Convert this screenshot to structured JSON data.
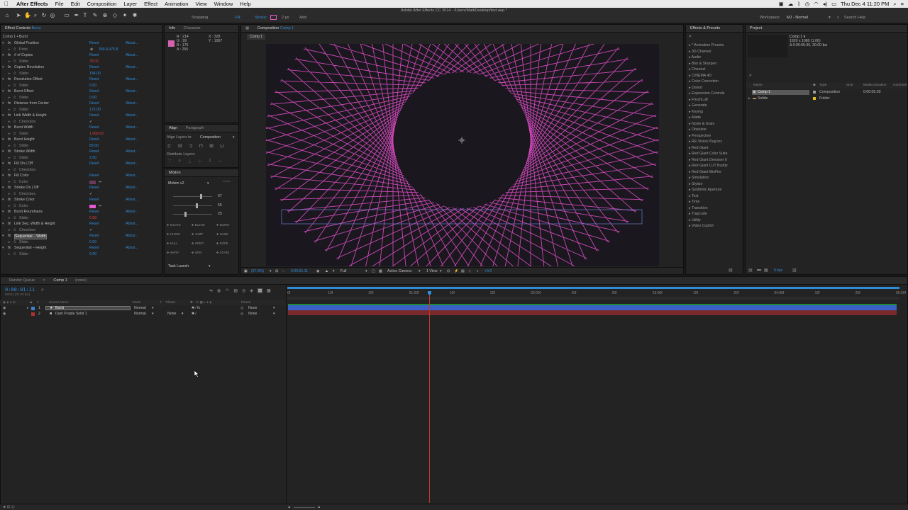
{
  "menubar": {
    "app_name": "After Effects",
    "items": [
      "File",
      "Edit",
      "Composition",
      "Layer",
      "Effect",
      "Animation",
      "View",
      "Window",
      "Help"
    ],
    "clock": "Thu Dec 4  11:20 PM"
  },
  "toolbar": {
    "window_title": "Adobe After Effects CC 2014 - /Users/Matt/Desktop/test.aep *",
    "snapping_label": "Snapping",
    "fill_label": "Fill:",
    "stroke_label": "Stroke:",
    "stroke_width": "2 px",
    "add_label": "Add:",
    "workspace_label": "Workspace:",
    "workspace_value": "MJ - Normal",
    "search_placeholder": "Search Help"
  },
  "effect_controls": {
    "tab_label": "Effect Controls",
    "tab_layer": "Burst",
    "breadcrumb": "Comp 1 • Burst",
    "reset_label": "Reset",
    "about_label": "About...",
    "rows": [
      {
        "kind": "fx",
        "label": "Global Position"
      },
      {
        "kind": "sub",
        "label": "Point",
        "value": "358.8,476.8",
        "red": false
      },
      {
        "kind": "fx",
        "label": "# of Copies"
      },
      {
        "kind": "sub",
        "label": "Slider",
        "value": "78.00",
        "red": true
      },
      {
        "kind": "fx",
        "label": "Copies Revolution"
      },
      {
        "kind": "sub",
        "label": "Slider",
        "value": "184.00",
        "red": false
      },
      {
        "kind": "fx",
        "label": "Revolution Offset"
      },
      {
        "kind": "sub",
        "label": "Slider",
        "value": "0.00",
        "red": false
      },
      {
        "kind": "fx",
        "label": "Burst Offset"
      },
      {
        "kind": "sub",
        "label": "Slider",
        "value": "0.00",
        "red": false
      },
      {
        "kind": "fx",
        "label": "Distance from Center"
      },
      {
        "kind": "sub",
        "label": "Slider",
        "value": "172.00",
        "red": false
      },
      {
        "kind": "fx",
        "label": "Link Width & Height"
      },
      {
        "kind": "sub",
        "label": "Checkbox",
        "value": "✓",
        "red": false
      },
      {
        "kind": "fx",
        "label": "Burst Width"
      },
      {
        "kind": "sub",
        "label": "Slider",
        "value": "1,068.00",
        "red": true
      },
      {
        "kind": "fx",
        "label": "Burst Height"
      },
      {
        "kind": "sub",
        "label": "Slider",
        "value": "89.00",
        "red": false
      },
      {
        "kind": "fx",
        "label": "Stroke Width"
      },
      {
        "kind": "sub",
        "label": "Slider",
        "value": "2.00",
        "red": false
      },
      {
        "kind": "fx",
        "label": "Fill On | Off"
      },
      {
        "kind": "sub",
        "label": "Checkbox",
        "value": "",
        "red": false
      },
      {
        "kind": "fx",
        "label": "Fill Color"
      },
      {
        "kind": "sub",
        "label": "Color",
        "value": "",
        "red": false,
        "swatch": "#6a3a5a"
      },
      {
        "kind": "fx",
        "label": "Stroke On | Off"
      },
      {
        "kind": "sub",
        "label": "Checkbox",
        "value": "✓",
        "red": false
      },
      {
        "kind": "fx",
        "label": "Stroke Color"
      },
      {
        "kind": "sub",
        "label": "Color",
        "value": "",
        "red": false,
        "swatch": "#e25ad0"
      },
      {
        "kind": "fx",
        "label": "Burst Roundness"
      },
      {
        "kind": "sub",
        "label": "Slider",
        "value": "0.00",
        "red": true
      },
      {
        "kind": "fx",
        "label": "Link Seq. Width & Height"
      },
      {
        "kind": "sub",
        "label": "Checkbox",
        "value": "✓",
        "red": false
      },
      {
        "kind": "fx",
        "label": "Sequential – Width"
      },
      {
        "kind": "sub",
        "label": "Slider",
        "value": "0.00",
        "red": false
      },
      {
        "kind": "fx",
        "label": "Sequential – Height"
      },
      {
        "kind": "sub",
        "label": "Slider",
        "value": "0.00",
        "red": false
      }
    ]
  },
  "info": {
    "tab_info": "Info",
    "tab_character": "Character",
    "r": "R : 214",
    "g": "G : 99",
    "b": "B : 176",
    "a": "A : 255",
    "x": "X : 328",
    "y": "Y : 1067",
    "swatch": "#d663b0"
  },
  "align": {
    "tab_align": "Align",
    "tab_paragraph": "Paragraph",
    "align_to_label": "Align Layers to:",
    "align_to_value": "Composition",
    "distribute_label": "Distribute Layers:"
  },
  "motion": {
    "tab": "Motion",
    "preset": "Motion v2",
    "values": [
      "67",
      "55",
      "25"
    ],
    "buttons": [
      "EXCITE",
      "BLEND",
      "BURST",
      "CLONE",
      "JUMP",
      "NAME",
      "NULL",
      "ORBIT",
      "ROPE",
      "WARP",
      "SPIN",
      "STARE"
    ],
    "task_launch": "Task Launch"
  },
  "composition": {
    "tab_label": "Composition",
    "tab_name": "Comp 1",
    "comp_tab": "Comp 1",
    "zoom": "(57.8%)",
    "timecode": "0:00:01:11",
    "resolution": "Full",
    "camera": "Active Camera",
    "view": "1 View",
    "exposure": "+0.0"
  },
  "effects_presets": {
    "tab_label": "Effects & Presets",
    "items": [
      "* Animation Presets",
      "3D Channel",
      "Audio",
      "Blur & Sharpen",
      "Channel",
      "CINEMA 4D",
      "Color Correction",
      "Distort",
      "Expression Controls",
      "FrischLuft",
      "Generate",
      "Keying",
      "Matte",
      "Noise & Grain",
      "Obsolete",
      "Perspective",
      "RE:Vision Plug-ins",
      "Red Giant",
      "Red Giant Color Suite",
      "Red Giant Denoiser II",
      "Red Giant LUT Buddy",
      "Red Giant MisFire",
      "Simulation",
      "Stylize",
      "Synthetic Aperture",
      "Text",
      "Time",
      "Transition",
      "Trapcode",
      "Utility",
      "Video Copilot"
    ]
  },
  "project": {
    "tab_label": "Project",
    "selected_name": "Comp 1 ▾",
    "selected_info1": "1920 x 1080 (1.00)",
    "selected_info2": "Δ 0:00:05:30, 30.00 fps",
    "col_name": "Name",
    "col_type": "Type",
    "col_size": "Size",
    "col_duration": "Media Duration",
    "col_comment": "Commen",
    "items": [
      {
        "name": "Comp 1",
        "type": "Composition",
        "duration": "0:00:05:30",
        "color": "#a0a0a0"
      },
      {
        "name": "Solids",
        "type": "Folder",
        "duration": "",
        "color": "#e0c020"
      }
    ],
    "bpc": "8 bpc"
  },
  "timeline": {
    "tab_render": "Render Queue",
    "tab_comp": "Comp 1",
    "tab_none": "(none)",
    "timecode": "0:00:01:11",
    "frame_info": "00043 (30.00 fps)",
    "col_source": "Source Name",
    "col_mode": "Mode",
    "col_t": "T",
    "col_trkmat": "TrkMat",
    "col_parent": "Parent",
    "layers": [
      {
        "num": "1",
        "name": "Burst",
        "mode": "Normal",
        "trkmat": "",
        "parent": "None",
        "label_color": "#3b82d0",
        "selected": true
      },
      {
        "num": "2",
        "name": "Dark Purple Solid 1",
        "mode": "Normal",
        "trkmat": "None",
        "parent": "None",
        "label_color": "#b03030",
        "selected": false
      }
    ],
    "ruler": [
      "0f",
      "10f",
      "20f",
      "01:00f",
      "10f",
      "20f",
      "02:00f",
      "10f",
      "20f",
      "03:00f",
      "10f",
      "20f",
      "04:00f",
      "10f",
      "20f",
      "05:00f"
    ]
  },
  "colors": {
    "accent": "#2e8bd6",
    "burst": "#e04cc8",
    "comp_bg": "#1a181e"
  }
}
